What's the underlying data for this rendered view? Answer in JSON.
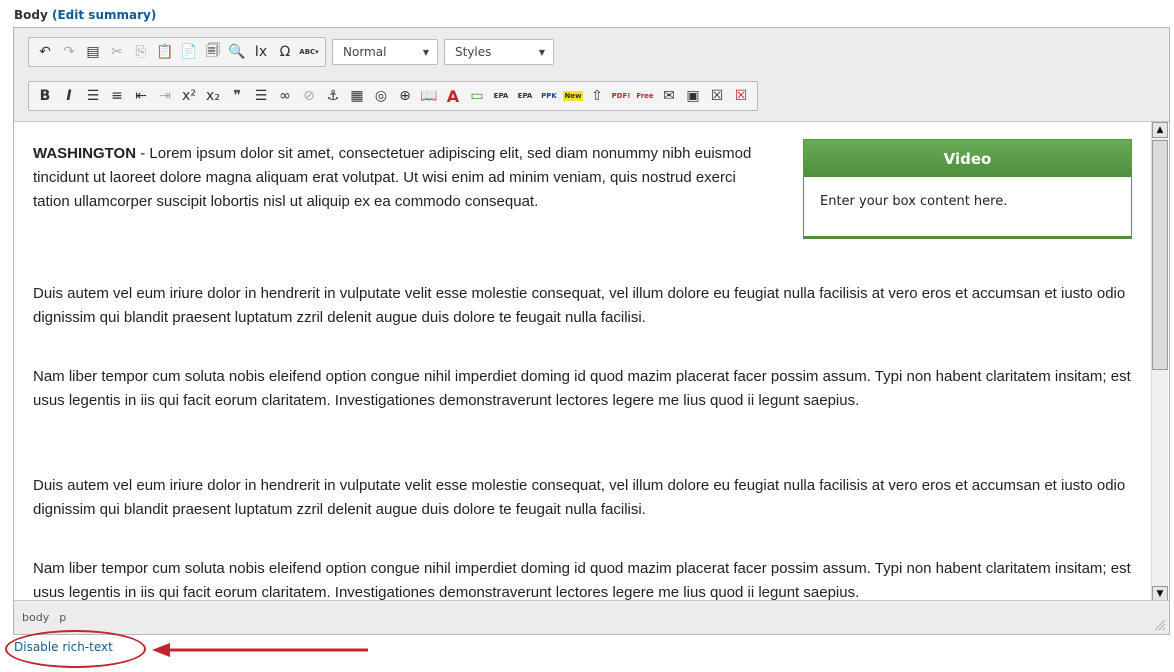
{
  "field": {
    "label": "Body",
    "edit_summary": "(Edit summary)"
  },
  "toolbar": {
    "row1_groups": [
      {
        "items": [
          {
            "name": "undo-icon",
            "glyph": "↶",
            "disabled": false
          },
          {
            "name": "redo-icon",
            "glyph": "↷",
            "disabled": true
          },
          {
            "name": "page-break-icon",
            "glyph": "▤",
            "disabled": false
          },
          {
            "name": "cut-icon",
            "glyph": "✂",
            "disabled": true
          },
          {
            "name": "copy-icon",
            "glyph": "⎘",
            "disabled": true
          },
          {
            "name": "paste-icon",
            "glyph": "📋",
            "disabled": false
          },
          {
            "name": "paste-text-icon",
            "glyph": "📄",
            "disabled": false
          },
          {
            "name": "paste-word-icon",
            "glyph": "🗐",
            "disabled": false
          },
          {
            "name": "find-icon",
            "glyph": "🔍",
            "disabled": false
          },
          {
            "name": "remove-format-icon",
            "glyph": "Ix",
            "disabled": false
          },
          {
            "name": "special-char-icon",
            "glyph": "Ω",
            "disabled": false
          },
          {
            "name": "spellcheck-icon",
            "glyph": "ABC▾",
            "disabled": false
          }
        ]
      }
    ],
    "format_select": "Normal",
    "styles_select": "Styles",
    "row2_groups": [
      {
        "items": [
          {
            "name": "bold-icon",
            "glyph": "B",
            "disabled": false
          },
          {
            "name": "italic-icon",
            "glyph": "I",
            "disabled": false
          },
          {
            "name": "bulleted-list-icon",
            "glyph": "☰",
            "disabled": false
          },
          {
            "name": "numbered-list-icon",
            "glyph": "≡",
            "disabled": false
          },
          {
            "name": "outdent-icon",
            "glyph": "⇤",
            "disabled": false
          },
          {
            "name": "indent-icon",
            "glyph": "⇥",
            "disabled": true
          },
          {
            "name": "superscript-icon",
            "glyph": "x²",
            "disabled": false
          },
          {
            "name": "subscript-icon",
            "glyph": "x₂",
            "disabled": false
          },
          {
            "name": "blockquote-icon",
            "glyph": "❞",
            "disabled": false
          },
          {
            "name": "horizontal-rule-icon",
            "glyph": "☰",
            "disabled": false
          },
          {
            "name": "link-icon",
            "glyph": "∞",
            "disabled": false
          },
          {
            "name": "unlink-icon",
            "glyph": "⊘",
            "disabled": true
          },
          {
            "name": "anchor-icon",
            "glyph": "⚓",
            "disabled": false
          },
          {
            "name": "table-icon",
            "glyph": "▦",
            "disabled": false
          },
          {
            "name": "globe-icon",
            "glyph": "◎",
            "disabled": false
          },
          {
            "name": "add-circle-icon",
            "glyph": "⊕",
            "disabled": false
          },
          {
            "name": "book-icon",
            "glyph": "📖",
            "disabled": false
          },
          {
            "name": "text-color-icon",
            "glyph": "A",
            "disabled": false
          },
          {
            "name": "box-icon",
            "glyph": "▭",
            "disabled": false
          },
          {
            "name": "epa-icon",
            "glyph": "EPA",
            "disabled": false
          },
          {
            "name": "epa-alt-icon",
            "glyph": "EPA",
            "disabled": false
          },
          {
            "name": "ppk-icon",
            "glyph": "PPK",
            "disabled": false
          },
          {
            "name": "new-badge-icon",
            "glyph": "New",
            "disabled": false
          },
          {
            "name": "up-arrow-icon",
            "glyph": "⇧",
            "disabled": false
          },
          {
            "name": "pdf-icon",
            "glyph": "PDF!",
            "disabled": false
          },
          {
            "name": "free-icon",
            "glyph": "Free",
            "disabled": false
          },
          {
            "name": "email-icon",
            "glyph": "✉",
            "disabled": false
          },
          {
            "name": "acrobat-icon",
            "glyph": "▣",
            "disabled": false
          },
          {
            "name": "acrobat-x-icon",
            "glyph": "☒",
            "disabled": false
          },
          {
            "name": "acrobat-x-red-icon",
            "glyph": "☒",
            "disabled": false
          }
        ]
      }
    ]
  },
  "body": {
    "dateline": "WASHINGTON",
    "lead": " - Lorem ipsum dolor sit amet, consectetuer adipiscing elit, sed diam nonummy nibh euismod tincidunt ut laoreet dolore magna aliquam erat volutpat. Ut wisi enim ad minim veniam, quis nostrud exerci tation ullamcorper suscipit lobortis nisl ut aliquip ex ea commodo consequat.",
    "p2": "Duis autem vel eum iriure dolor in hendrerit in vulputate velit esse molestie consequat, vel illum dolore eu feugiat nulla facilisis at vero eros et accumsan et iusto odio dignissim qui blandit praesent luptatum zzril delenit augue duis dolore te feugait nulla facilisi.",
    "p3": "Nam liber tempor cum soluta nobis eleifend option congue nihil imperdiet doming id quod mazim placerat facer possim assum. Typi non habent claritatem insitam; est usus legentis in iis qui facit eorum claritatem. Investigationes demonstraverunt lectores legere me lius quod ii legunt saepius.",
    "p4": "Duis autem vel eum iriure dolor in hendrerit in vulputate velit esse molestie consequat, vel illum dolore eu feugiat nulla facilisis at vero eros et accumsan et iusto odio dignissim qui blandit praesent luptatum zzril delenit augue duis dolore te feugait nulla facilisi.",
    "p5": "Nam liber tempor cum soluta nobis eleifend option congue nihil imperdiet doming id quod mazim placerat facer possim assum. Typi non habent claritatem insitam; est usus legentis in iis qui facit eorum claritatem. Investigationes demonstraverunt lectores legere me lius quod ii legunt saepius."
  },
  "video_box": {
    "title": "Video",
    "content": "Enter your box content here."
  },
  "path_bar": [
    "body",
    "p"
  ],
  "disable_rich_text": "Disable rich-text",
  "colors": {
    "accent_link": "#0d5c99",
    "box_green": "#5a9a4a",
    "annotation_red": "#c0262a",
    "text_color_icon": "#c0262a"
  }
}
